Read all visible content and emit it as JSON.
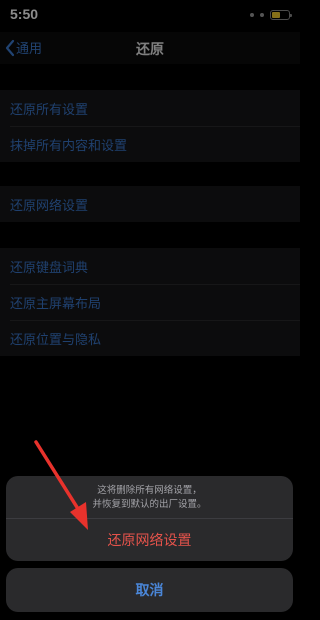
{
  "status_bar": {
    "time": "5:50",
    "battery_level": 0.45,
    "battery_color": "#f5cc2e"
  },
  "nav": {
    "back_label": "通用",
    "title": "还原"
  },
  "groups": [
    {
      "items": [
        "还原所有设置",
        "抹掉所有内容和设置"
      ]
    },
    {
      "items": [
        "还原网络设置"
      ]
    },
    {
      "items": [
        "还原键盘词典",
        "还原主屏幕布局",
        "还原位置与隐私"
      ]
    }
  ],
  "action_sheet": {
    "message_line1": "这将删除所有网络设置，",
    "message_line2": "并恢复到默认的出厂设置。",
    "confirm_label": "还原网络设置",
    "cancel_label": "取消"
  },
  "colors": {
    "link": "#3a76c9",
    "destructive": "#e5534b",
    "annotation_arrow": "#e8322c"
  },
  "icons": [
    "chevron-left-icon",
    "signal-icon",
    "battery-icon",
    "annotation-arrow"
  ]
}
